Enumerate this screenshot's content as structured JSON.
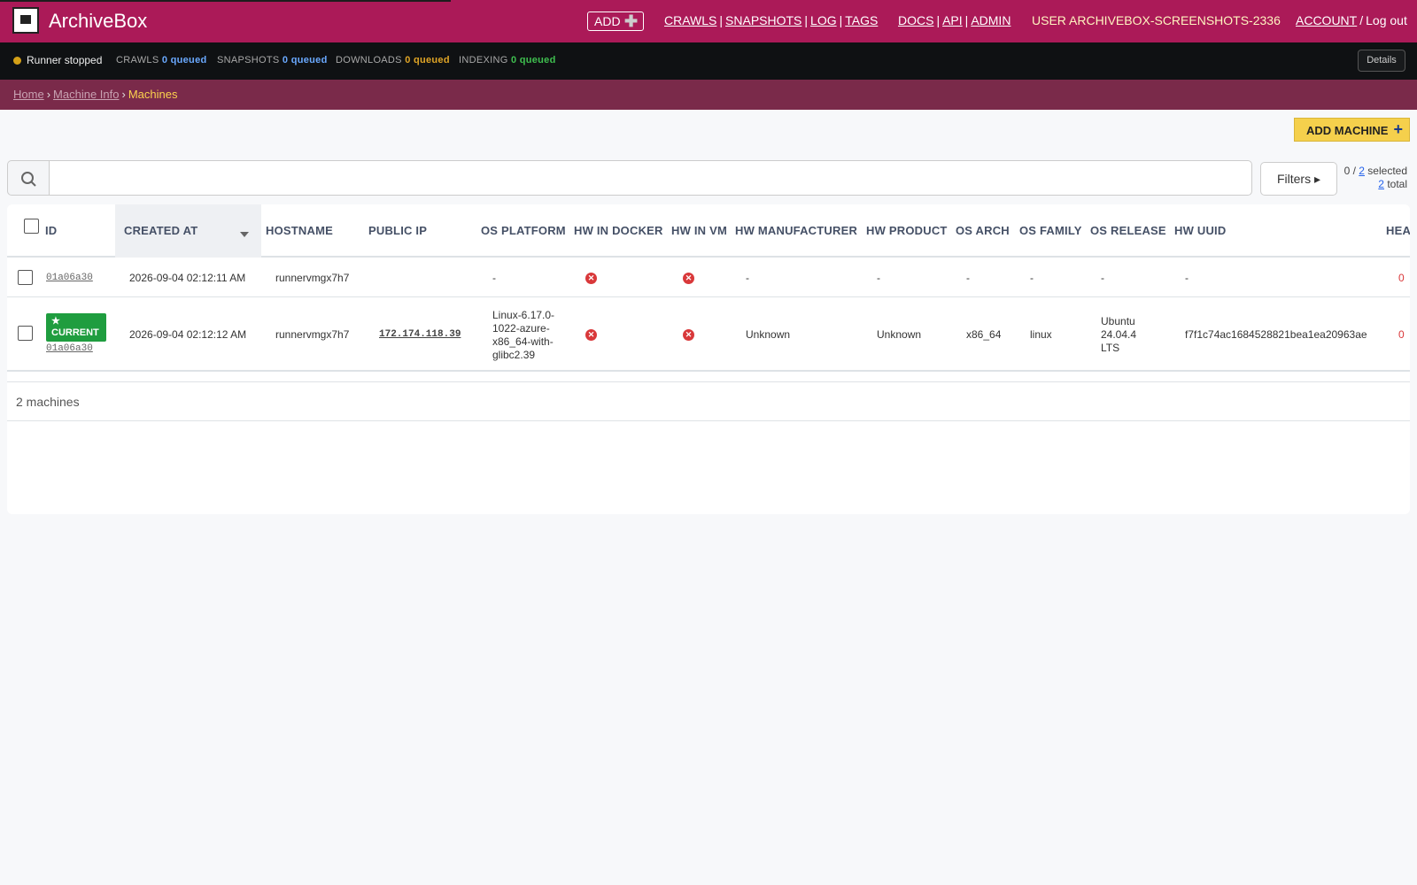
{
  "header": {
    "brand": "ArchiveBox",
    "add_label": "ADD",
    "nav_main": [
      "CRAWLS",
      "SNAPSHOTS",
      "LOG",
      "TAGS"
    ],
    "nav_docs": [
      "DOCS",
      "API",
      "ADMIN"
    ],
    "user_label": "USER ARCHIVEBOX-SCREENSHOTS-2336",
    "account_label": "ACCOUNT",
    "logout_label": "Log out",
    "brand_color": "#ab1a58"
  },
  "status": {
    "runner_text": "Runner stopped",
    "crawls_label": "CRAWLS",
    "crawls_value": "0 queued",
    "snapshots_label": "SNAPSHOTS",
    "snapshots_value": "0 queued",
    "downloads_label": "DOWNLOADS",
    "downloads_value": "0 queued",
    "indexing_label": "INDEXING",
    "indexing_value": "0 queued",
    "details_label": "Details"
  },
  "breadcrumb": {
    "home": "Home",
    "machine_info": "Machine Info",
    "current": "Machines"
  },
  "toolbar": {
    "add_machine_label": "ADD MACHINE",
    "search_placeholder": "",
    "filters_label": "Filters ▸",
    "selected_prefix": "0 / ",
    "selected_count": "2",
    "selected_suffix": " selected",
    "total_count": "2",
    "total_suffix": " total"
  },
  "table": {
    "columns": [
      "ID",
      "CREATED AT",
      "HOSTNAME",
      "PUBLIC IP",
      "OS PLATFORM",
      "HW IN DOCKER",
      "HW IN VM",
      "HW MANUFACTURER",
      "HW PRODUCT",
      "OS ARCH",
      "OS FAMILY",
      "OS RELEASE",
      "HW UUID",
      "HEA"
    ],
    "rows": [
      {
        "id": "01a06a30",
        "created_at": "2026-09-04 02:12:11 AM",
        "hostname": "runnervmgx7h7",
        "public_ip": "",
        "os_platform": "-",
        "hw_manufacturer": "-",
        "hw_product": "-",
        "os_arch": "-",
        "os_family": "-",
        "os_release": "-",
        "hw_uuid": "-",
        "health": "0"
      },
      {
        "badge": "★\nCURRENT",
        "id": "01a06a30",
        "created_at": "2026-09-04 02:12:12 AM",
        "hostname": "runnervmgx7h7",
        "public_ip": "172.174.118.39",
        "os_platform": "Linux-6.17.0-1022-azure-x86_64-with-glibc2.39",
        "hw_manufacturer": "Unknown",
        "hw_product": "Unknown",
        "os_arch": "x86_64",
        "os_family": "linux",
        "os_release": "Ubuntu 24.04.4 LTS",
        "hw_uuid": "f7f1c74ac1684528821bea1ea20963ae",
        "health": "0"
      }
    ],
    "count_label": "2 machines"
  }
}
